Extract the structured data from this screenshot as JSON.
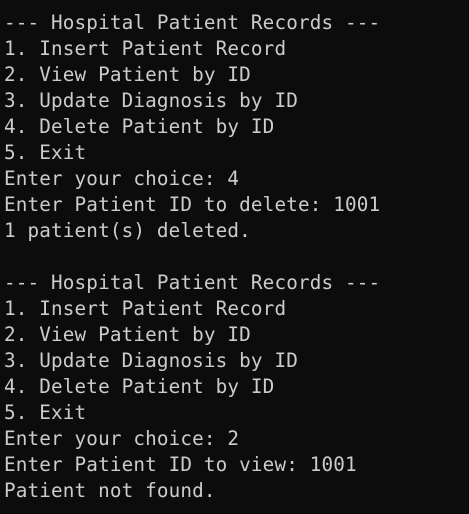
{
  "terminal": {
    "lines": [
      "--- Hospital Patient Records ---",
      "1. Insert Patient Record",
      "2. View Patient by ID",
      "3. Update Diagnosis by ID",
      "4. Delete Patient by ID",
      "5. Exit",
      "Enter your choice: 4",
      "Enter Patient ID to delete: 1001",
      "1 patient(s) deleted.",
      "",
      "--- Hospital Patient Records ---",
      "1. Insert Patient Record",
      "2. View Patient by ID",
      "3. Update Diagnosis by ID",
      "4. Delete Patient by ID",
      "5. Exit",
      "Enter your choice: 2",
      "Enter Patient ID to view: 1001",
      "Patient not found."
    ]
  }
}
